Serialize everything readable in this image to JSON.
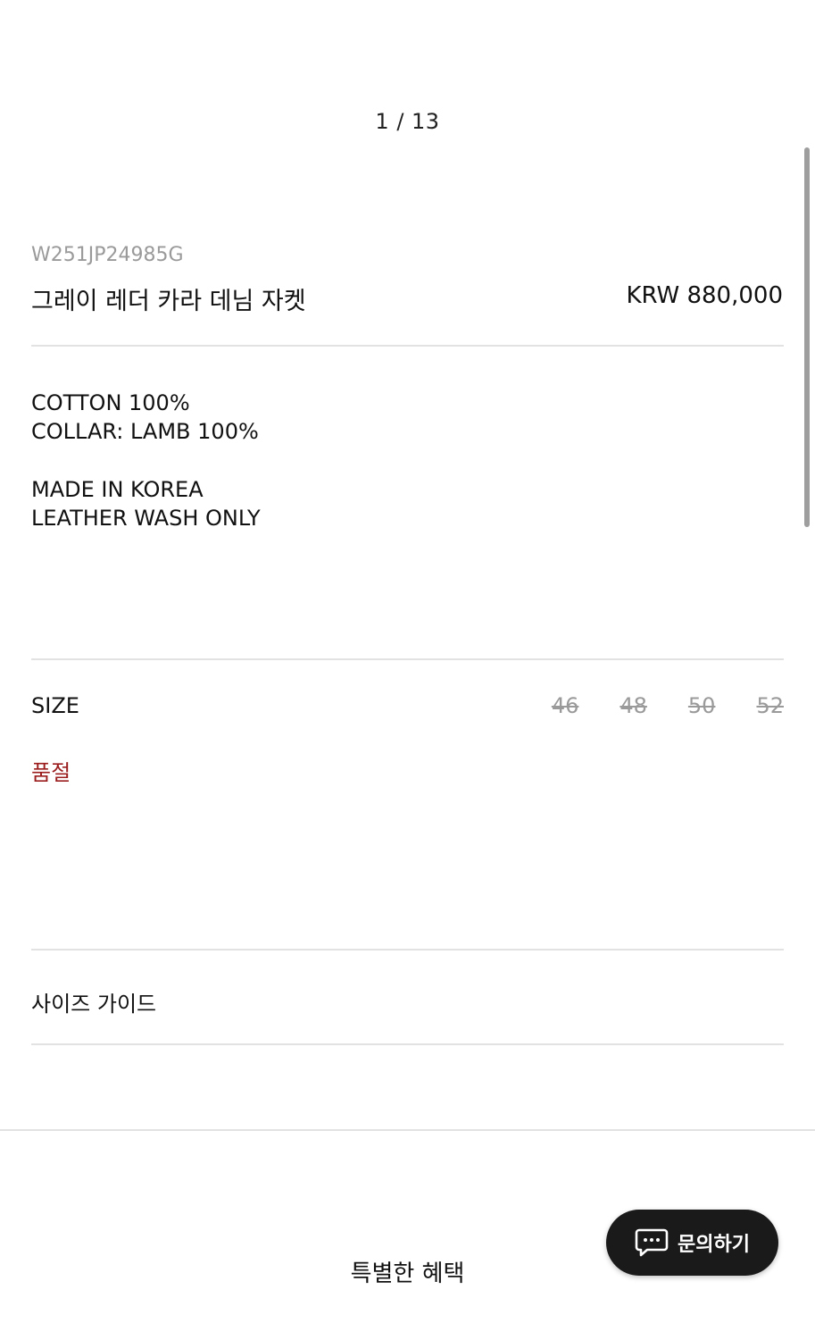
{
  "gallery": {
    "pager_text": "1 / 13"
  },
  "product": {
    "sku": "W251JP24985G",
    "name": "그레이 레더 카라 데님 자켓",
    "price": "KRW 880,000"
  },
  "description": {
    "lines_group1": [
      "COTTON 100%",
      "COLLAR: LAMB 100%"
    ],
    "lines_group2": [
      "MADE IN KOREA",
      "LEATHER WASH ONLY"
    ]
  },
  "size": {
    "label": "SIZE",
    "options": [
      "46",
      "48",
      "50",
      "52"
    ],
    "status": "품절",
    "status_color": "#9b1c1c"
  },
  "size_guide": {
    "label": "사이즈 가이드"
  },
  "benefits": {
    "title": "특별한 혜택"
  },
  "inquiry": {
    "label": "문의하기",
    "icon": "chat-bubble-icon"
  }
}
